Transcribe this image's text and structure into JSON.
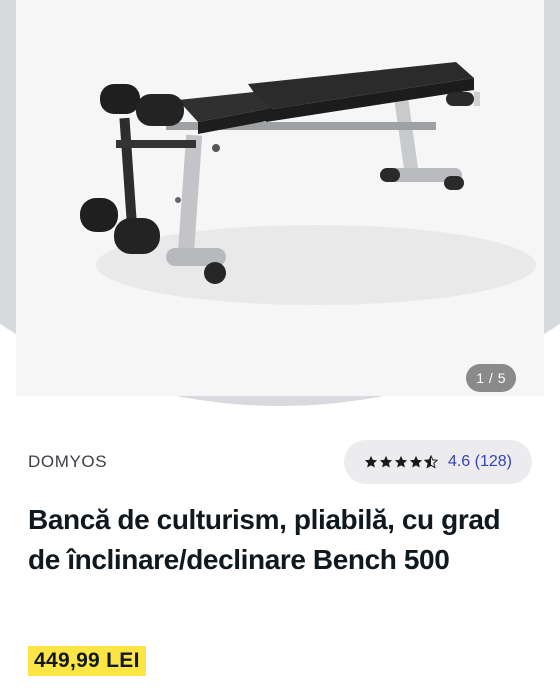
{
  "gallery": {
    "image_alt": "Bancă de culturism, pliabilă",
    "pager_text": "1 / 5",
    "current_index": 1,
    "total": 5
  },
  "product": {
    "brand": "DOMYOS",
    "rating": {
      "stars_value": 4.5,
      "stars_max": 5,
      "label": "4.6 (128)"
    },
    "title": "Bancă de culturism, pliabilă, cu grad de înclinare/declinare Bench 500",
    "price": "449,99 LEI"
  },
  "colors": {
    "accent": "#3643ba",
    "price_highlight": "#fde545",
    "pill_bg": "#ececee"
  },
  "icons": [
    "star-icon",
    "half-star-icon"
  ]
}
